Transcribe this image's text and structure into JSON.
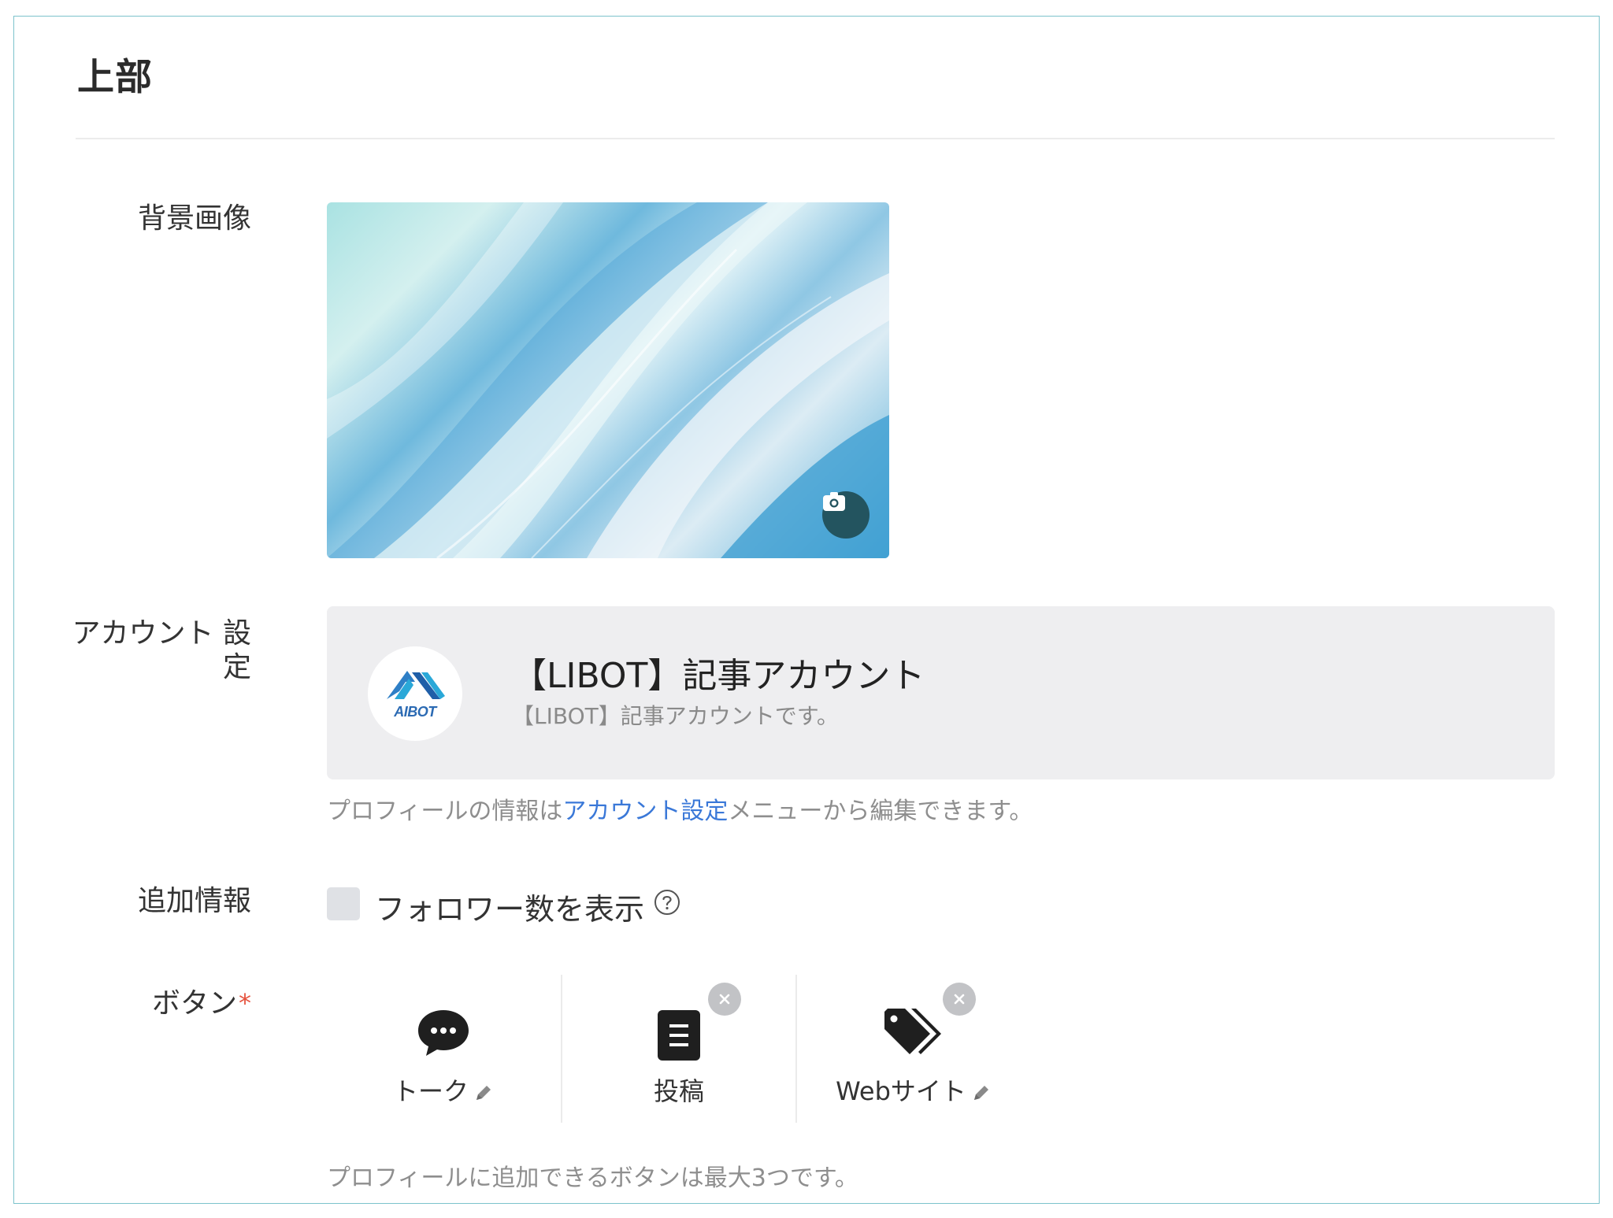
{
  "section": {
    "title": "上部"
  },
  "background_image": {
    "label": "背景画像",
    "camera_icon": "camera-icon"
  },
  "account": {
    "label_line1": "アカウント 設",
    "label_line2": "定",
    "name": "【LIBOT】記事アカウント",
    "description": "【LIBOT】記事アカウントです。",
    "avatar_text": "AIBOT",
    "help_prefix": "プロフィールの情報は",
    "help_link": "アカウント設定",
    "help_suffix": "メニューから編集できます。"
  },
  "additional": {
    "label": "追加情報",
    "checkbox_label": "フォロワー数を表示",
    "checked": false
  },
  "buttons": {
    "label": "ボタン",
    "required_mark": "*",
    "items": [
      {
        "label": "トーク",
        "icon": "chat-bubble-icon",
        "editable": true,
        "removable": false
      },
      {
        "label": "投稿",
        "icon": "document-icon",
        "editable": false,
        "removable": true
      },
      {
        "label": "Webサイト",
        "icon": "tag-icon",
        "editable": true,
        "removable": true
      }
    ],
    "help": "プロフィールに追加できるボタンは最大3つです。"
  },
  "colors": {
    "border": "#7cc3cc",
    "link": "#3a78d8",
    "required": "#e5533f",
    "card_bg": "#eeeef0",
    "camera_btn": "#23545f"
  }
}
